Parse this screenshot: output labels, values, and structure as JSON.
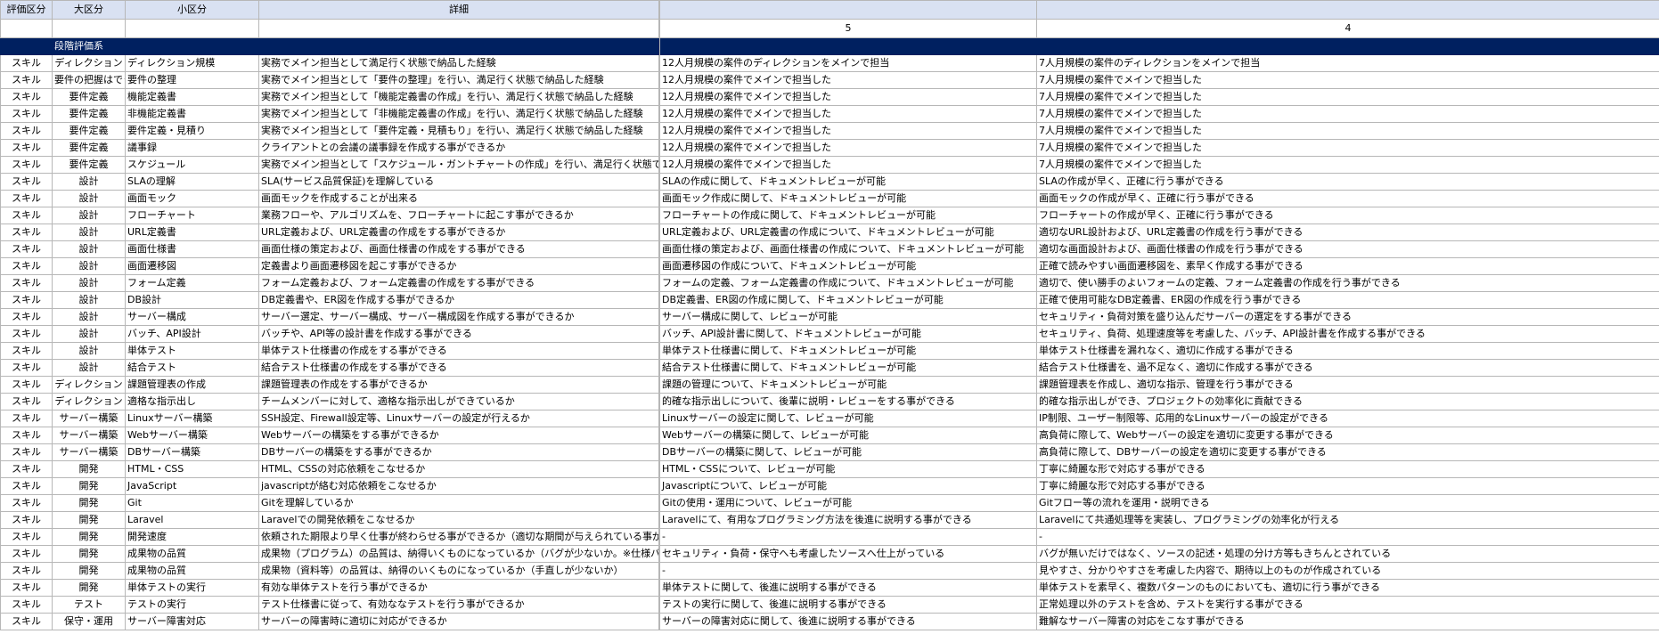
{
  "headers": {
    "col0": "評価区分",
    "col1": "大区分",
    "col2": "小区分",
    "col3": "詳細",
    "level5": "5",
    "level4": "4"
  },
  "band_label": "段階評価系",
  "rows": [
    {
      "c0": "スキル",
      "c1": "ディレクション",
      "c2": "ディレクション規模",
      "c3": "実務でメイン担当として満足行く状態で納品した経験",
      "c5": "12人月規模の案件のディレクションをメインで担当",
      "c4": "7人月規模の案件のディレクションをメインで担当"
    },
    {
      "c0": "スキル",
      "c1": "要件の把握はでき",
      "c2": "要件の整理",
      "c3": "実務でメイン担当として「要件の整理」を行い、満足行く状態で納品した経験",
      "c5": "12人月規模の案件でメインで担当した",
      "c4": "7人月規模の案件でメインで担当した",
      "left": true
    },
    {
      "c0": "スキル",
      "c1": "要件定義",
      "c2": "機能定義書",
      "c3": "実務でメイン担当として「機能定義書の作成」を行い、満足行く状態で納品した経験",
      "c5": "12人月規模の案件でメインで担当した",
      "c4": "7人月規模の案件でメインで担当した"
    },
    {
      "c0": "スキル",
      "c1": "要件定義",
      "c2": "非機能定義書",
      "c3": "実務でメイン担当として「非機能定義書の作成」を行い、満足行く状態で納品した経験",
      "c5": "12人月規模の案件でメインで担当した",
      "c4": "7人月規模の案件でメインで担当した"
    },
    {
      "c0": "スキル",
      "c1": "要件定義",
      "c2": "要件定義・見積り",
      "c3": "実務でメイン担当として「要件定義・見積もり」を行い、満足行く状態で納品した経験",
      "c5": "12人月規模の案件でメインで担当した",
      "c4": "7人月規模の案件でメインで担当した"
    },
    {
      "c0": "スキル",
      "c1": "要件定義",
      "c2": "議事録",
      "c3": "クライアントとの会議の議事録を作成する事ができるか",
      "c5": "12人月規模の案件でメインで担当した",
      "c4": "7人月規模の案件でメインで担当した"
    },
    {
      "c0": "スキル",
      "c1": "要件定義",
      "c2": "スケジュール",
      "c3": "実務でメイン担当として「スケジュール・ガントチャートの作成」を行い、満足行く状態で納品し",
      "c5": "12人月規模の案件でメインで担当した",
      "c4": "7人月規模の案件でメインで担当した"
    },
    {
      "c0": "スキル",
      "c1": "設計",
      "c2": "SLAの理解",
      "c3": "SLA(サービス品質保証)を理解している",
      "c5": "SLAの作成に関して、ドキュメントレビューが可能",
      "c4": "SLAの作成が早く、正確に行う事ができる"
    },
    {
      "c0": "スキル",
      "c1": "設計",
      "c2": "画面モック",
      "c3": "画面モックを作成することが出来る",
      "c5": "画面モック作成に関して、ドキュメントレビューが可能",
      "c4": "画面モックの作成が早く、正確に行う事ができる"
    },
    {
      "c0": "スキル",
      "c1": "設計",
      "c2": "フローチャート",
      "c3": "業務フローや、アルゴリズムを、フローチャートに起こす事ができるか",
      "c5": "フローチャートの作成に関して、ドキュメントレビューが可能",
      "c4": "フローチャートの作成が早く、正確に行う事ができる"
    },
    {
      "c0": "スキル",
      "c1": "設計",
      "c2": "URL定義書",
      "c3": "URL定義および、URL定義書の作成をする事ができるか",
      "c5": "URL定義および、URL定義書の作成について、ドキュメントレビューが可能",
      "c4": "適切なURL設計および、URL定義書の作成を行う事ができる"
    },
    {
      "c0": "スキル",
      "c1": "設計",
      "c2": "画面仕様書",
      "c3": "画面仕様の策定および、画面仕様書の作成をする事ができる",
      "c5": "画面仕様の策定および、画面仕様書の作成について、ドキュメントレビューが可能",
      "c4": "適切な画面設計および、画面仕様書の作成を行う事ができる"
    },
    {
      "c0": "スキル",
      "c1": "設計",
      "c2": "画面遷移図",
      "c3": "定義書より画面遷移図を起こす事ができるか",
      "c5": "画面遷移図の作成について、ドキュメントレビューが可能",
      "c4": "正確で読みやすい画面遷移図を、素早く作成する事ができる"
    },
    {
      "c0": "スキル",
      "c1": "設計",
      "c2": "フォーム定義",
      "c3": "フォーム定義および、フォーム定義書の作成をする事ができる",
      "c5": "フォームの定義、フォーム定義書の作成について、ドキュメントレビューが可能",
      "c4": "適切で、使い勝手のよいフォームの定義、フォーム定義書の作成を行う事ができる"
    },
    {
      "c0": "スキル",
      "c1": "設計",
      "c2": "DB設計",
      "c3": "DB定義書や、ER図を作成する事ができるか",
      "c5": "DB定義書、ER図の作成に関して、ドキュメントレビューが可能",
      "c4": "正確で使用可能なDB定義書、ER図の作成を行う事ができる"
    },
    {
      "c0": "スキル",
      "c1": "設計",
      "c2": "サーバー構成",
      "c3": "サーバー選定、サーバー構成、サーバー構成図を作成する事ができるか",
      "c5": "サーバー構成に関して、レビューが可能",
      "c4": "セキュリティ・負荷対策を盛り込んだサーバーの選定をする事ができる"
    },
    {
      "c0": "スキル",
      "c1": "設計",
      "c2": "バッチ、API設計",
      "c3": "バッチや、API等の設計書を作成する事ができる",
      "c5": "バッチ、API設計書に関して、ドキュメントレビューが可能",
      "c4": "セキュリティ、負荷、処理速度等を考慮した、バッチ、API設計書を作成する事ができる"
    },
    {
      "c0": "スキル",
      "c1": "設計",
      "c2": "単体テスト",
      "c3": "単体テスト仕様書の作成をする事ができる",
      "c5": "単体テスト仕様書に関して、ドキュメントレビューが可能",
      "c4": "単体テスト仕様書を漏れなく、適切に作成する事ができる"
    },
    {
      "c0": "スキル",
      "c1": "設計",
      "c2": "結合テスト",
      "c3": "結合テスト仕様書の作成をする事ができる",
      "c5": "結合テスト仕様書に関して、ドキュメントレビューが可能",
      "c4": "結合テスト仕様書を、過不足なく、適切に作成する事ができる"
    },
    {
      "c0": "スキル",
      "c1": "ディレクション",
      "c2": "課題管理表の作成",
      "c3": "課題管理表の作成をする事ができるか",
      "c5": "課題の管理について、ドキュメントレビューが可能",
      "c4": "課題管理表を作成し、適切な指示、管理を行う事ができる"
    },
    {
      "c0": "スキル",
      "c1": "ディレクション",
      "c2": "適格な指示出し",
      "c3": "チームメンバーに対して、適格な指示出しができているか",
      "c5": "的確な指示出しについて、後輩に説明・レビューをする事ができる",
      "c4": "的確な指示出しができ、プロジェクトの効率化に貢献できる"
    },
    {
      "c0": "スキル",
      "c1": "サーバー構築",
      "c2": "Linuxサーバー構築",
      "c3": "SSH設定、Firewall設定等、Linuxサーバーの設定が行えるか",
      "c5": "Linuxサーバーの設定に関して、レビューが可能",
      "c4": "IP制限、ユーザー制限等、応用的なLinuxサーバーの設定ができる"
    },
    {
      "c0": "スキル",
      "c1": "サーバー構築",
      "c2": "Webサーバー構築",
      "c3": "Webサーバーの構築をする事ができるか",
      "c5": "Webサーバーの構築に関して、レビューが可能",
      "c4": "高負荷に際して、Webサーバーの設定を適切に変更する事ができる"
    },
    {
      "c0": "スキル",
      "c1": "サーバー構築",
      "c2": "DBサーバー構築",
      "c3": "DBサーバーの構築をする事ができるか",
      "c5": "DBサーバーの構築に関して、レビューが可能",
      "c4": "高負荷に際して、DBサーバーの設定を適切に変更する事ができる"
    },
    {
      "c0": "スキル",
      "c1": "開発",
      "c2": "HTML・CSS",
      "c3": "HTML、CSSの対応依頼をこなせるか",
      "c5": "HTML・CSSについて、レビューが可能",
      "c4": "丁寧に綺麗な形で対応する事ができる"
    },
    {
      "c0": "スキル",
      "c1": "開発",
      "c2": "JavaScript",
      "c3": "javascriptが絡む対応依頼をこなせるか",
      "c5": "Javascriptについて、レビューが可能",
      "c4": "丁寧に綺麗な形で対応する事ができる"
    },
    {
      "c0": "スキル",
      "c1": "開発",
      "c2": "Git",
      "c3": "Gitを理解しているか",
      "c5": "Gitの使用・運用について、レビューが可能",
      "c4": "Gitフロー等の流れを運用・説明できる"
    },
    {
      "c0": "スキル",
      "c1": "開発",
      "c2": "Laravel",
      "c3": "Laravelでの開発依頼をこなせるか",
      "c5": "Laravelにて、有用なプログラミング方法を後進に説明する事ができる",
      "c4": "Laravelにて共通処理等を実装し、プログラミングの効率化が行える"
    },
    {
      "c0": "スキル",
      "c1": "開発",
      "c2": "開発速度",
      "c3": "依頼された期限より早く仕事が終わらせる事ができるか（適切な期間が与えられている事が前提）",
      "c5": "-",
      "c4": "-"
    },
    {
      "c0": "スキル",
      "c1": "開発",
      "c2": "成果物の品質",
      "c3": "成果物（プログラム）の品質は、納得いくものになっているか（バグが少ないか。※仕様バグは",
      "c5": "セキュリティ・負荷・保守へも考慮したソースへ仕上がっている",
      "c4": "バグが無いだけではなく、ソースの記述・処理の分け方等もきちんとされている"
    },
    {
      "c0": "スキル",
      "c1": "開発",
      "c2": "成果物の品質",
      "c3": "成果物（資料等）の品質は、納得のいくものになっているか（手直しが少ないか）",
      "c5": "-",
      "c4": "見やすさ、分かりやすさを考慮した内容で、期待以上のものが作成されている"
    },
    {
      "c0": "スキル",
      "c1": "開発",
      "c2": "単体テストの実行",
      "c3": "有効な単体テストを行う事ができるか",
      "c5": "単体テストに関して、後進に説明する事ができる",
      "c4": "単体テストを素早く、複数パターンのものにおいても、適切に行う事ができる"
    },
    {
      "c0": "スキル",
      "c1": "テスト",
      "c2": "テストの実行",
      "c3": "テスト仕様書に従って、有効ななテストを行う事ができるか",
      "c5": "テストの実行に関して、後進に説明する事ができる",
      "c4": "正常処理以外のテストを含め、テストを実行する事ができる"
    },
    {
      "c0": "スキル",
      "c1": "保守・運用",
      "c2": "サーバー障害対応",
      "c3": "サーバーの障害時に適切に対応ができるか",
      "c5": "サーバーの障害対応に関して、後進に説明する事ができる",
      "c4": "難解なサーバー障害の対応をこなす事ができる"
    }
  ]
}
